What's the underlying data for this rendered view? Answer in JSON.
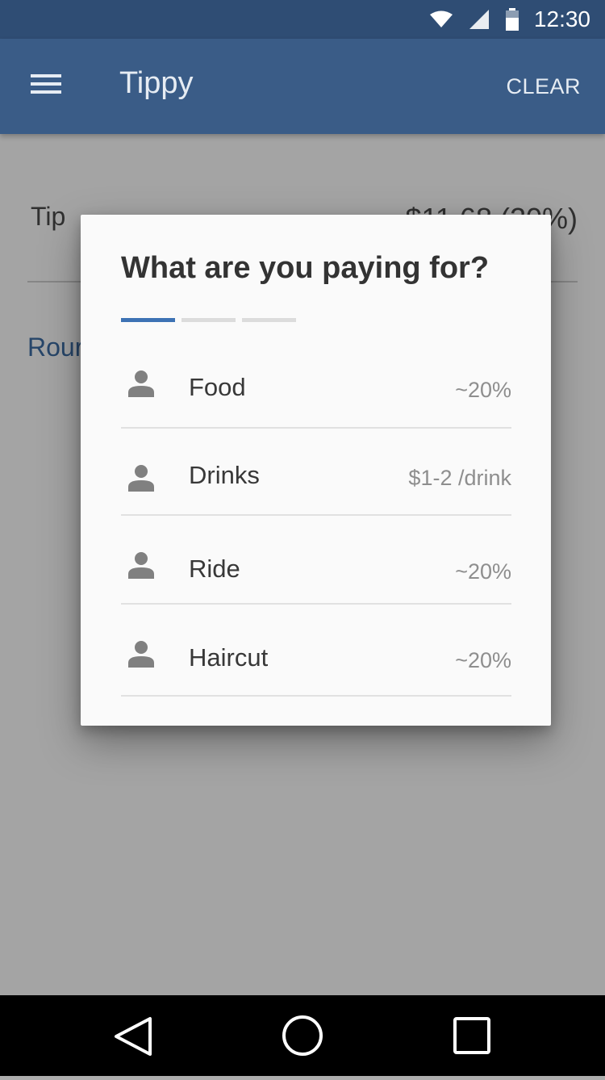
{
  "status_bar": {
    "time": "12:30",
    "icons": [
      "wifi-icon",
      "cell-signal-icon",
      "battery-icon"
    ]
  },
  "app_bar": {
    "menu_icon": "hamburger-menu-icon",
    "title": "Tippy",
    "clear_label": "CLEAR",
    "color": "#3a5c87"
  },
  "background": {
    "tip_label": "Tip",
    "tip_value": "$11.68 (20%)",
    "round_label": "Rour"
  },
  "dialog": {
    "title": "What are you paying for?",
    "steps": {
      "total": 3,
      "active": 1,
      "accent": "#3d72b4"
    },
    "options": [
      {
        "icon": "person-icon",
        "label": "Food",
        "hint": "~20%"
      },
      {
        "icon": "person-icon",
        "label": "Drinks",
        "hint": "$1-2 /drink"
      },
      {
        "icon": "person-icon",
        "label": "Ride",
        "hint": "~20%"
      },
      {
        "icon": "person-icon",
        "label": "Haircut",
        "hint": "~20%"
      }
    ]
  },
  "nav_bar": {
    "buttons": [
      "back-icon",
      "home-icon",
      "recents-icon"
    ]
  }
}
